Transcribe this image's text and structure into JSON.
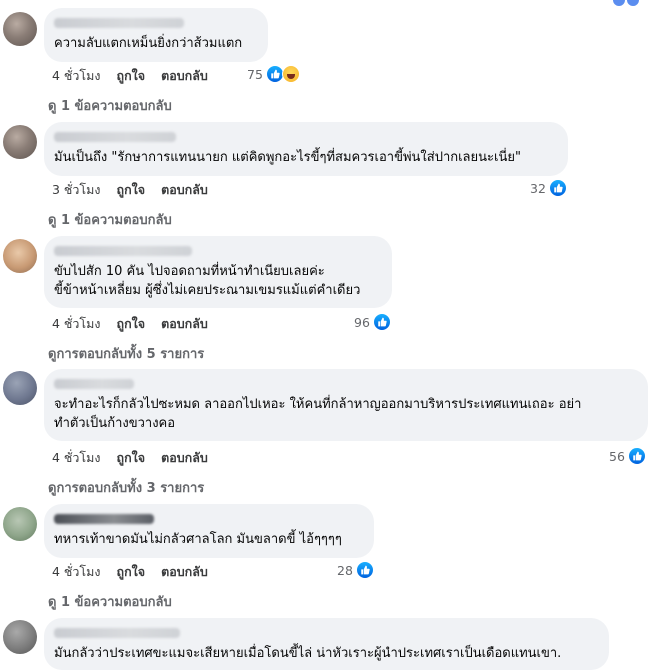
{
  "comments": [
    {
      "text": "ความลับแตกเหม็นยิ่งกว่าส้วมแตก",
      "time": "4 ชั่วโมง",
      "like_label": "ถูกใจ",
      "reply_label": "ตอบกลับ",
      "reaction_count": "75",
      "reaction_icons": [
        "like-icon",
        "haha-icon"
      ],
      "replies_link": "ดู 1 ข้อความตอบกลับ"
    },
    {
      "text": "มันเป็นถึง \"รักษาการแทนนายก แต่คิดพูกอะไรขี้ๆที่สมควรเอาขี้พ่นใส่ปากเลยนะเนี่ย\"",
      "time": "3 ชั่วโมง",
      "like_label": "ถูกใจ",
      "reply_label": "ตอบกลับ",
      "reaction_count": "32",
      "reaction_icons": [
        "like-icon"
      ],
      "replies_link": "ดู 1 ข้อความตอบกลับ"
    },
    {
      "text": "ขับไปสัก 10 คัน ไปจอดถามที่หน้าทำเนียบเลยค่ะ\nขี้ข้าหน้าเหลี่ยม ผู้ซึ่งไม่เคยประณามเขมรแม้แต่คำเดียว",
      "time": "4 ชั่วโมง",
      "like_label": "ถูกใจ",
      "reply_label": "ตอบกลับ",
      "reaction_count": "96",
      "reaction_icons": [
        "like-icon"
      ],
      "replies_link": "ดูการตอบกลับทั้ง 5 รายการ"
    },
    {
      "text": "จะทำอะไรก็กลัวไปซะหมด ลาออกไปเหอะ ให้คนที่กล้าหาญออกมาบริหารประเทศแทนเถอะ อย่า\nทำตัวเป็นก้างขวางคอ",
      "time": "4 ชั่วโมง",
      "like_label": "ถูกใจ",
      "reply_label": "ตอบกลับ",
      "reaction_count": "56",
      "reaction_icons": [
        "like-icon"
      ],
      "replies_link": "ดูการตอบกลับทั้ง 3 รายการ"
    },
    {
      "text": "ทหารเท้าขาดมันไม่กลัวศาลโลก มันขลาดขี้ ไอ้ๆๆๆๆ",
      "time": "4 ชั่วโมง",
      "like_label": "ถูกใจ",
      "reply_label": "ตอบกลับ",
      "reaction_count": "28",
      "reaction_icons": [
        "like-icon"
      ],
      "replies_link": "ดู 1 ข้อความตอบกลับ"
    },
    {
      "text": "มันกลัวว่าประเทศขะแมจะเสียหายเมื่อโดนขี้ไล่ น่าหัวเราะผู้นำประเทศเราเป็นเดือดแทนเขา.",
      "time": "",
      "like_label": "",
      "reply_label": "",
      "reaction_count": "",
      "reaction_icons": [],
      "replies_link": ""
    }
  ],
  "colors": {
    "bubble": "#f0f2f5",
    "like_blue": "#0866ff",
    "meta_text": "#65676b"
  }
}
